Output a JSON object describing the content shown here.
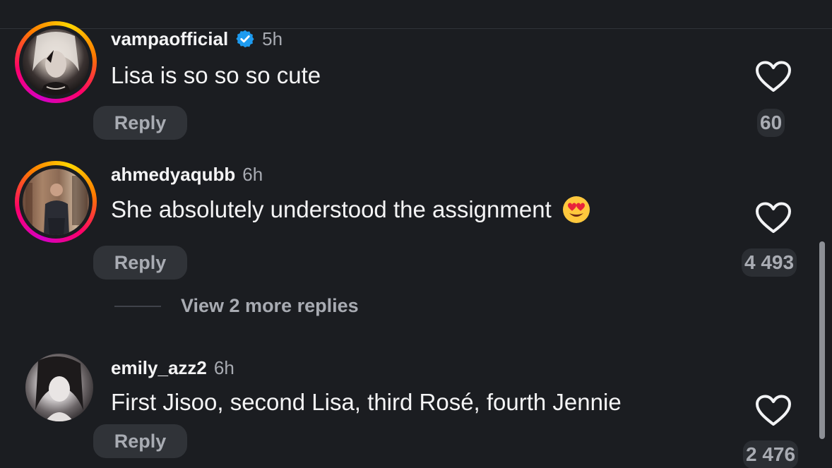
{
  "comments": [
    {
      "username": "vampaofficial",
      "verified": true,
      "time": "5h",
      "text": "Lisa is so so so cute",
      "reply_label": "Reply",
      "likes": "60",
      "icons": [
        "verified-badge-icon",
        "heart-icon"
      ]
    },
    {
      "username": "ahmedyaqubb",
      "verified": false,
      "time": "6h",
      "text": "She absolutely understood the assignment",
      "emoji": "heart-eyes-emoji",
      "reply_label": "Reply",
      "likes": "4 493",
      "view_more": "View 2 more replies"
    },
    {
      "username": "emily_azz2",
      "verified": false,
      "time": "6h",
      "text": "First Jisoo, second Lisa, third Rosé, fourth Jennie",
      "reply_label": "Reply",
      "likes": "2 476"
    }
  ],
  "colors": {
    "background": "#1b1d21",
    "verified_blue": "#1d9bf0",
    "muted_text": "#a8abb2",
    "pill_bg": "#303338"
  }
}
